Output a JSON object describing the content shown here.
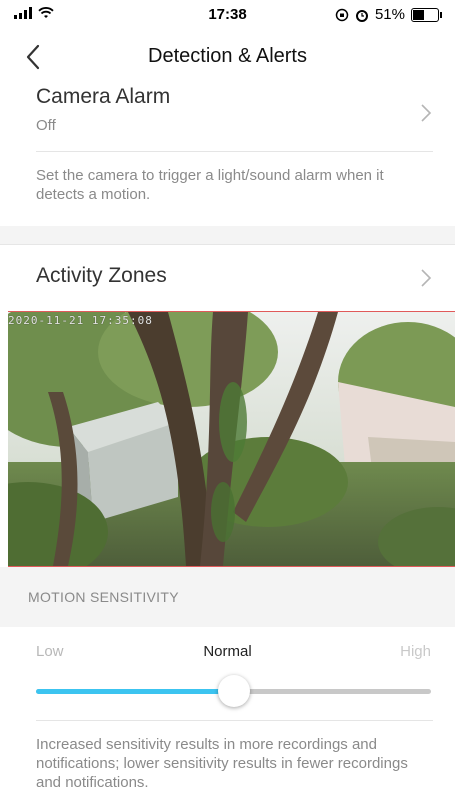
{
  "status_bar": {
    "time": "17:38",
    "battery": "51%",
    "battery_level": 0.51
  },
  "nav": {
    "title": "Detection & Alerts",
    "back_icon": "chevron-left-icon"
  },
  "camera_alarm": {
    "label": "Camera Alarm",
    "value": "Off",
    "description": "Set the camera to trigger a light/sound alarm when it detects a motion."
  },
  "activity_zones": {
    "label": "Activity Zones",
    "camera_timestamp": "2020-11-21 17:35:08"
  },
  "motion_sensitivity": {
    "header": "MOTION SENSITIVITY",
    "low_label": "Low",
    "normal_label": "Normal",
    "high_label": "High",
    "level": 0.5,
    "description": "Increased sensitivity results in more recordings and notifications; lower sensitivity results in fewer recordings and notifications."
  },
  "colors": {
    "accent": "#3cc4f0",
    "zone_border": "#e05a5a"
  }
}
